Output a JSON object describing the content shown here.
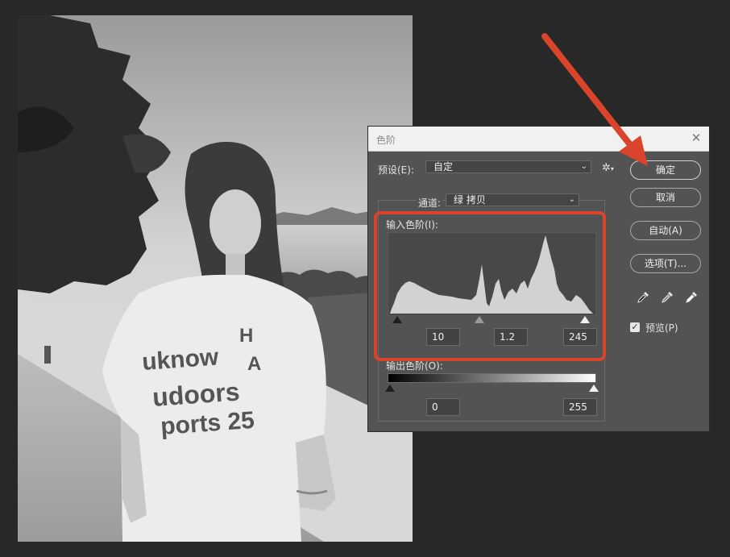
{
  "dialog": {
    "title": "色阶",
    "preset_label": "预设(E):",
    "preset_value": "自定",
    "channel_label": "通道:",
    "channel_value": "绿 拷贝",
    "input_levels_label": "输入色阶(I):",
    "input_black": "10",
    "input_gamma": "1.2",
    "input_white": "245",
    "output_levels_label": "输出色阶(O):",
    "output_black": "0",
    "output_white": "255",
    "buttons": {
      "ok": "确定",
      "cancel": "取消",
      "auto": "自动(A)",
      "options": "选项(T)..."
    },
    "preview_label": "预览(P)",
    "preview_checked": true
  },
  "photo": {
    "shirt_text": [
      "uknow",
      "H",
      "A",
      "udoors",
      "ports 25"
    ]
  },
  "icons": [
    "close-icon",
    "gear-icon",
    "chevron-down-icon",
    "black-eyedropper-icon",
    "gray-eyedropper-icon",
    "white-eyedropper-icon",
    "checkbox-check-icon"
  ],
  "colors": {
    "accent_annotation": "#d9442a",
    "dialog_bg": "#535353",
    "histogram_fill": "#d2d2d2",
    "histogram_bg": "#484848"
  }
}
